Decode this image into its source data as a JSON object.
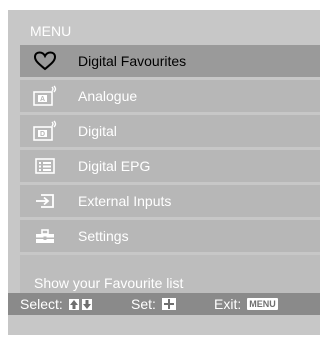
{
  "menu": {
    "title": "MENU",
    "items": [
      {
        "label": "Digital Favourites",
        "icon": "heart-icon",
        "selected": true
      },
      {
        "label": "Analogue",
        "icon": "analogue-tv-icon",
        "selected": false
      },
      {
        "label": "Digital",
        "icon": "digital-tv-icon",
        "selected": false
      },
      {
        "label": "Digital EPG",
        "icon": "epg-icon",
        "selected": false
      },
      {
        "label": "External Inputs",
        "icon": "external-inputs-icon",
        "selected": false
      },
      {
        "label": "Settings",
        "icon": "toolbox-icon",
        "selected": false
      }
    ],
    "description": "Show your Favourite list"
  },
  "help": {
    "select_label": "Select:",
    "set_label": "Set:",
    "exit_label": "Exit:",
    "exit_key": "MENU"
  }
}
